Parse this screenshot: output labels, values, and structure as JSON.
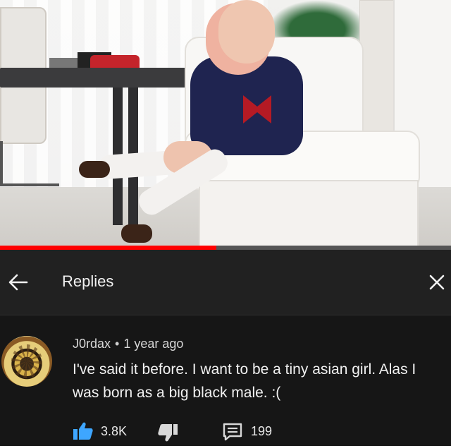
{
  "video": {
    "progress_fraction": 0.48,
    "progress_color": "#ff0000"
  },
  "header": {
    "title": "Replies",
    "back_icon": "arrow-left-icon",
    "close_icon": "close-icon"
  },
  "comment": {
    "author": "J0rdax",
    "separator": "•",
    "time": "1 year ago",
    "text": "I've said it before. I want to be a tiny asian girl. Alas I was born as a big black male. :(",
    "like_count": "3.8K",
    "reply_count": "199",
    "like_color": "#3ea6ff"
  }
}
